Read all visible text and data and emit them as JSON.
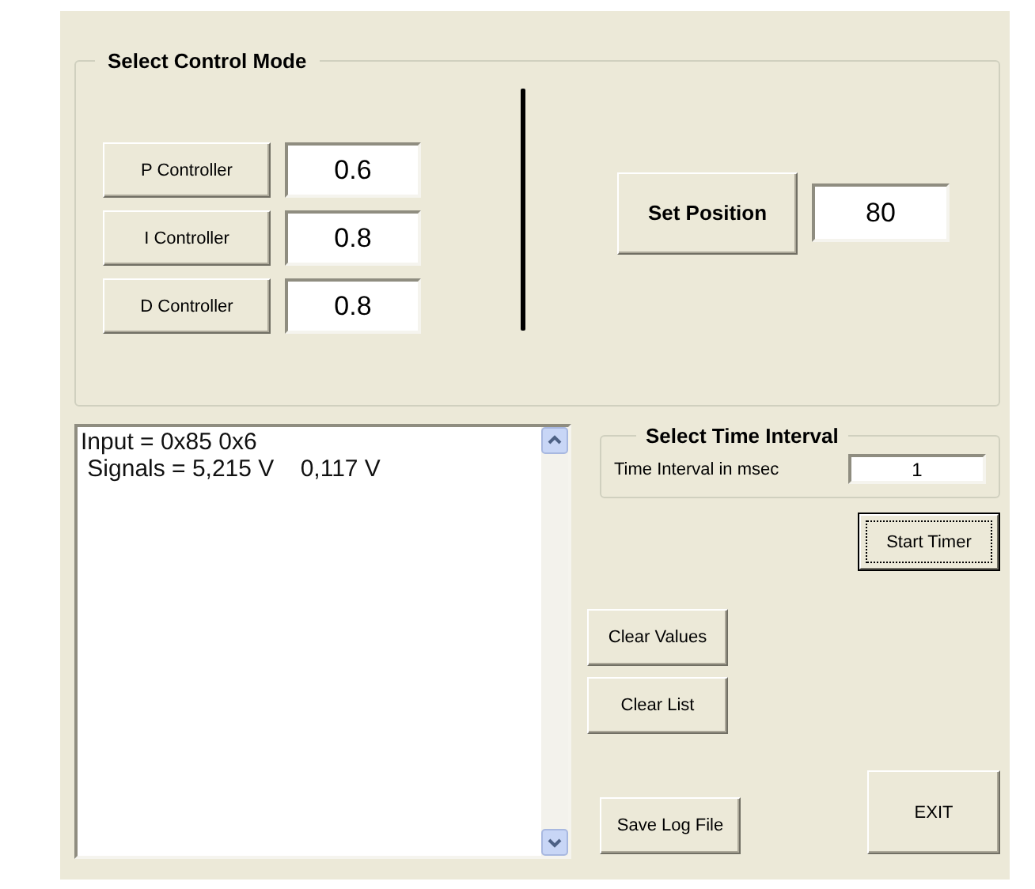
{
  "control_mode": {
    "title": "Select Control Mode",
    "gains": [
      {
        "button": "P Controller",
        "value": "0.6"
      },
      {
        "button": "I Controller",
        "value": "0.8"
      },
      {
        "button": "D Controller",
        "value": "0.8"
      }
    ],
    "set_position": {
      "button": "Set Position",
      "value": "80"
    }
  },
  "log_list": {
    "lines": [
      "Input = 0x85 0x6",
      " Signals = 5,215 V    0,117 V"
    ]
  },
  "time_interval": {
    "title": "Select Time Interval",
    "label": "Time Interval in msec",
    "value": "1"
  },
  "buttons": [
    {
      "label": "Start Timer",
      "focused": true
    },
    {
      "label": "Clear Values",
      "focused": false
    },
    {
      "label": "Clear List",
      "focused": false
    },
    {
      "label": "Save Log File",
      "focused": false
    },
    {
      "label": "EXIT",
      "focused": false
    }
  ]
}
